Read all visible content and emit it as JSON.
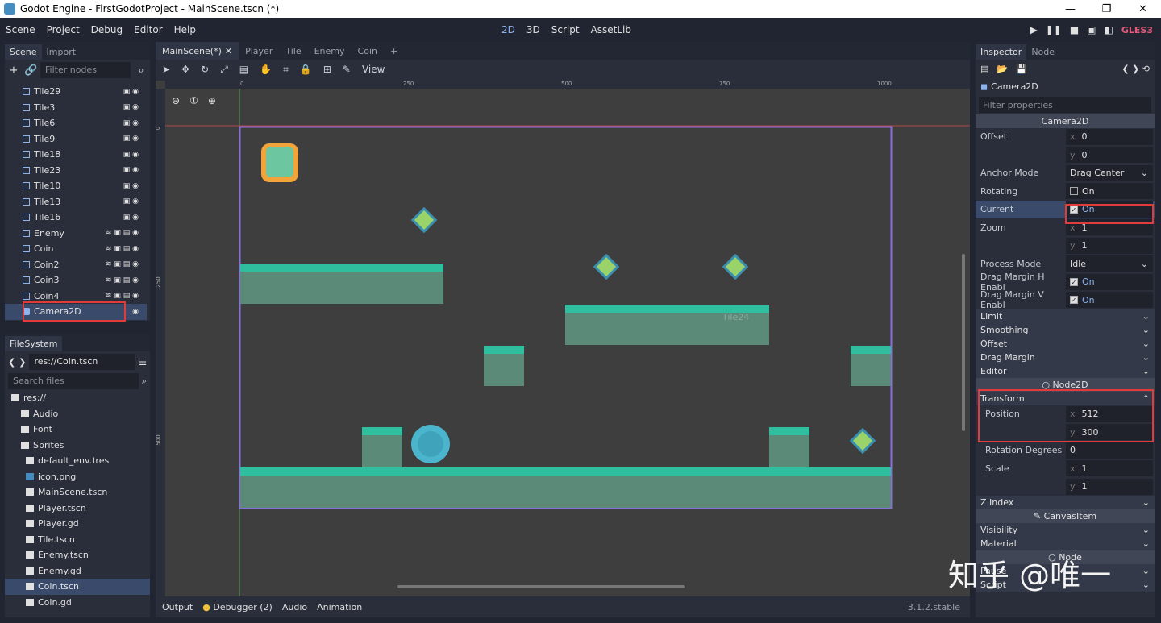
{
  "window": {
    "title": "Godot Engine - FirstGodotProject - MainScene.tscn (*)"
  },
  "menu": [
    "Scene",
    "Project",
    "Debug",
    "Editor",
    "Help"
  ],
  "workspaces": [
    "2D",
    "3D",
    "Script",
    "AssetLib"
  ],
  "renderer": "GLES3",
  "scene_panel": {
    "tabs": [
      "Scene",
      "Import"
    ],
    "filter_placeholder": "Filter nodes",
    "nodes": [
      "Tile29",
      "Tile3",
      "Tile6",
      "Tile9",
      "Tile18",
      "Tile23",
      "Tile10",
      "Tile13",
      "Tile16",
      "Enemy",
      "Coin",
      "Coin2",
      "Coin3",
      "Coin4",
      "Camera2D"
    ]
  },
  "filesystem": {
    "tab": "FileSystem",
    "path": "res://Coin.tscn",
    "search_placeholder": "Search files",
    "items": [
      "res://",
      "Audio",
      "Font",
      "Sprites",
      "default_env.tres",
      "icon.png",
      "MainScene.tscn",
      "Player.tscn",
      "Player.gd",
      "Tile.tscn",
      "Enemy.tscn",
      "Enemy.gd",
      "Coin.tscn",
      "Coin.gd"
    ]
  },
  "scene_tabs": [
    "MainScene(*)",
    "Player",
    "Tile",
    "Enemy",
    "Coin"
  ],
  "viewport": {
    "view_menu": "View",
    "ruler_labels": [
      "0",
      "250",
      "500",
      "750",
      "1000"
    ],
    "ruler_v_labels": [
      "0",
      "250",
      "500"
    ],
    "node_label": "Tile24"
  },
  "bottom_tabs": [
    "Output",
    "Debugger (2)",
    "Audio",
    "Animation"
  ],
  "version": "3.1.2.stable",
  "inspector": {
    "tabs": [
      "Inspector",
      "Node"
    ],
    "node": "Camera2D",
    "filter_placeholder": "Filter properties",
    "section": "Camera2D",
    "offset": {
      "label": "Offset",
      "x": "0",
      "y": "0"
    },
    "anchor_mode": {
      "label": "Anchor Mode",
      "value": "Drag Center"
    },
    "rotating": {
      "label": "Rotating",
      "value": "On"
    },
    "current": {
      "label": "Current",
      "value": "On"
    },
    "zoom": {
      "label": "Zoom",
      "x": "1",
      "y": "1"
    },
    "process_mode": {
      "label": "Process Mode",
      "value": "Idle"
    },
    "drag_h": {
      "label": "Drag Margin H Enabl",
      "value": "On"
    },
    "drag_v": {
      "label": "Drag Margin V Enabl",
      "value": "On"
    },
    "groups": [
      "Limit",
      "Smoothing",
      "Offset",
      "Drag Margin",
      "Editor"
    ],
    "node2d": "Node2D",
    "transform": "Transform",
    "position": {
      "label": "Position",
      "x": "512",
      "y": "300"
    },
    "rotation": {
      "label": "Rotation Degrees",
      "value": "0"
    },
    "scale": {
      "label": "Scale",
      "x": "1",
      "y": "1"
    },
    "zindex": "Z Index",
    "canvasitem": "CanvasItem",
    "canvas_groups": [
      "Visibility",
      "Material"
    ],
    "nodesec": "Node",
    "node_groups": [
      "Pause",
      "Script"
    ]
  },
  "watermark": "知乎 @唯一"
}
